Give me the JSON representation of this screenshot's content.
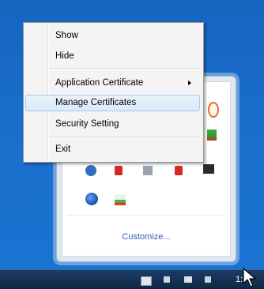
{
  "context_menu": {
    "items": [
      {
        "label": "Show"
      },
      {
        "label": "Hide"
      },
      {
        "label": "Application Certificate",
        "has_submenu": true
      },
      {
        "label": "Manage Certificates",
        "highlighted": true
      },
      {
        "label": "Security Setting"
      },
      {
        "label": "Exit"
      }
    ]
  },
  "overflow_panel": {
    "customize_label": "Customize...",
    "icons": [
      "orange-app-icon",
      "green-app-icon",
      "blue-app-icon",
      "red-shield-icon",
      "gray-app-icon",
      "red-shield-icon",
      "network-icon",
      "blue-globe-icon",
      "chart-icon"
    ]
  },
  "taskbar": {
    "clock_text": "1:"
  },
  "colors": {
    "desktop_blue": "#1a6fcc",
    "menu_highlight": "#dceafa",
    "link_blue": "#2d64b3"
  }
}
